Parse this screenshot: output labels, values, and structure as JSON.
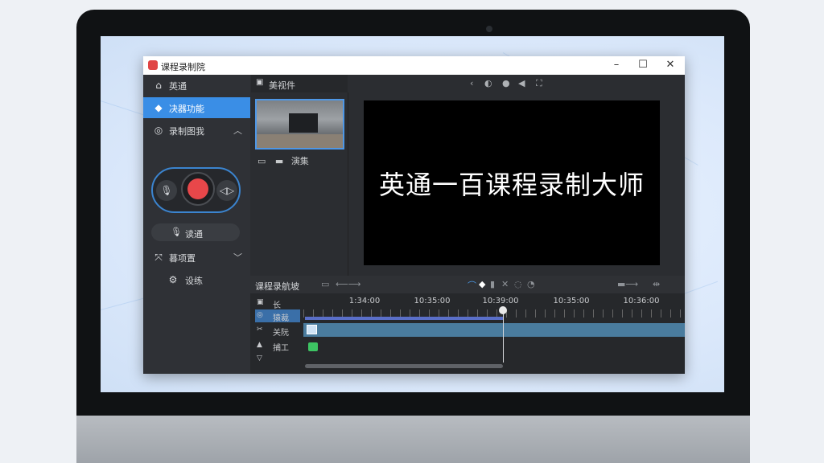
{
  "window": {
    "title": "课程录制院",
    "controls": {
      "minimize": "–",
      "maximize": "☐",
      "close": "✕"
    }
  },
  "sidebar": {
    "items": [
      {
        "label": "英通",
        "icon": "home-icon"
      },
      {
        "label": "决器功能",
        "icon": "puzzle-icon",
        "active": true
      },
      {
        "label": "录制图我",
        "icon": "palette-icon",
        "expanded": true
      }
    ],
    "voice_label": "读通",
    "items_lower": [
      {
        "label": "暮项置",
        "icon": "crop-icon"
      },
      {
        "label": "设练",
        "icon": "settings-icon"
      }
    ]
  },
  "media_panel": {
    "tab_label": "美视件",
    "item_label": "演集"
  },
  "preview": {
    "text": "英通一百课程录制大师"
  },
  "timeline": {
    "title": "课程录航坡",
    "tracks": [
      {
        "label": "长",
        "icon": "film-icon"
      },
      {
        "label": "猿裁",
        "icon": "target-icon",
        "selected": true
      },
      {
        "label": "关阮",
        "icon": "scissors-icon"
      },
      {
        "label": "捕工",
        "icon": "bell-icon"
      },
      {
        "label": "",
        "icon": "shield-icon"
      }
    ],
    "time_labels": [
      "1:34:00",
      "10:35:00",
      "10:39:00",
      "10:35:00",
      "10:36:00"
    ],
    "progress_fraction": 0.52
  },
  "colors": {
    "accent": "#3a8ee6",
    "record": "#e8474a",
    "audio_clip": "#3dc463"
  }
}
